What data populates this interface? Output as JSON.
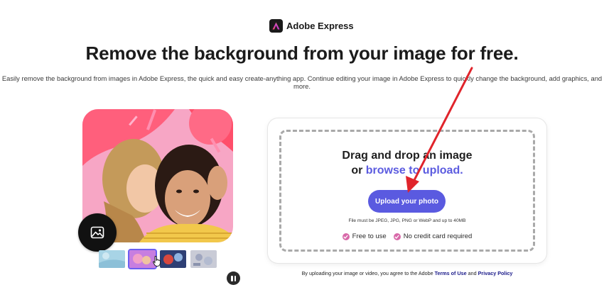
{
  "brand": {
    "name": "Adobe Express",
    "logo_icon": "adobe-express-logo"
  },
  "headline": "Remove the background from your image for free.",
  "subhead": "Easily remove the background from images in Adobe Express, the quick and easy create-anything app. Continue editing your image in Adobe Express to quickly change the background, add graphics, and more.",
  "hero": {
    "image_icon": "image-icon"
  },
  "thumbnails": {
    "count": 4,
    "active_index": 1
  },
  "upload": {
    "drag_line1": "Drag and drop an image",
    "drag_or": "or",
    "browse_link": "browse to upload.",
    "button_label": "Upload your photo",
    "file_note": "File must be JPEG, JPG, PNG or WebP and up to 40MB",
    "perk_free": "Free to use",
    "perk_no_card": "No credit card required"
  },
  "legal": {
    "prefix": "By uploading your image or video, you agree to the Adobe",
    "terms_link": "Terms of Use",
    "and": "and",
    "privacy_link": "Privacy Policy"
  },
  "colors": {
    "accent": "#5a5ae0",
    "link": "#5c5ce0",
    "check": "#d869a9",
    "annotation_arrow": "#e0242b"
  }
}
